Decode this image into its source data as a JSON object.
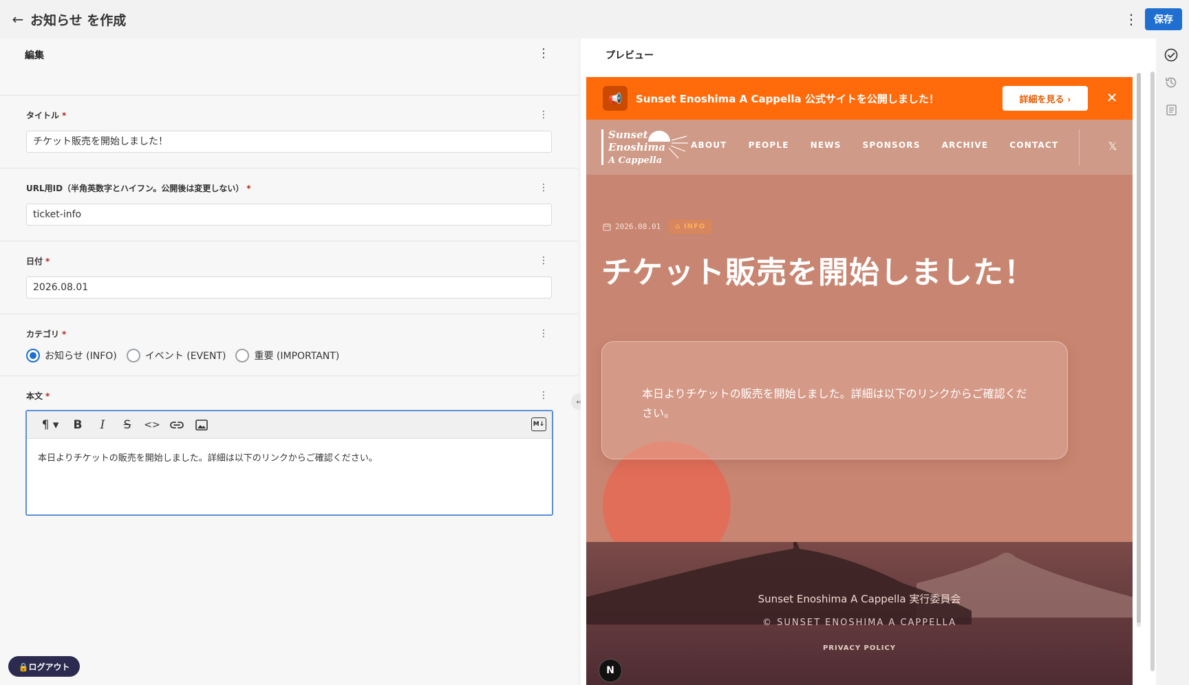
{
  "header": {
    "back_label": "←",
    "title": "お知らせ を作成",
    "more_label": "⋮",
    "save_label": "保存"
  },
  "editor_pane": {
    "title": "編集",
    "more_label": "⋮",
    "fields": {
      "title": {
        "label": "タイトル",
        "required_mark": "*",
        "value": "チケット販売を開始しました！"
      },
      "slug": {
        "label": "URL用ID（半角英数字とハイフン。公開後は変更しない）",
        "required_mark": "*",
        "value": "ticket-info"
      },
      "date": {
        "label": "日付",
        "required_mark": "*",
        "value": "2026.08.01"
      },
      "category": {
        "label": "カテゴリ",
        "required_mark": "*",
        "options": [
          {
            "label": "お知らせ (INFO)",
            "checked": true
          },
          {
            "label": "イベント (EVENT)",
            "checked": false
          },
          {
            "label": "重要 (IMPORTANT)",
            "checked": false
          }
        ]
      },
      "body": {
        "label": "本文",
        "required_mark": "*",
        "toolbar": {
          "paragraph": "¶ ▾",
          "bold": "B",
          "italic": "I",
          "strike": "S",
          "code": "<>",
          "link": "🔗",
          "image": "▣",
          "markdown": "M↓"
        },
        "value": "本日よりチケットの販売を開始しました。詳細は以下のリンクからご確認ください。"
      }
    },
    "field_more_label": "⋮"
  },
  "splitter_label": "↔",
  "logout_label": "🔒ログアウト",
  "preview_pane": {
    "title": "プレビュー",
    "banner": {
      "icon": "megaphone-icon",
      "icon_glyph": "📢",
      "text": "Sunset Enoshima A Cappella 公式サイトを公開しました！",
      "button_label": "詳細を見る ›",
      "close_label": "✕"
    },
    "nav": {
      "logo_lines": [
        "Sunset",
        "Enoshima",
        "A Cappella"
      ],
      "links": [
        "ABOUT",
        "PEOPLE",
        "NEWS",
        "SPONSORS",
        "ARCHIVE",
        "CONTACT"
      ],
      "social_label": "𝕏"
    },
    "post": {
      "date": "2026.08.01",
      "category": "INFO",
      "title": "チケット販売を開始しました！",
      "body": "本日よりチケットの販売を開始しました。詳細は以下のリンクからご確認ください。"
    },
    "footer": {
      "org": "Sunset Enoshima A Cappella 実行委員会",
      "copyright": "© SUNSET ENOSHIMA A CAPPELLA",
      "privacy": "PRIVACY POLICY",
      "badge": "N"
    }
  },
  "right_rail": {
    "icons": [
      "check-circle-icon",
      "history-icon",
      "document-list-icon"
    ]
  },
  "colors": {
    "accent": "#1f6fd1",
    "required": "#b3261e",
    "banner": "#ff6a0a",
    "site_bg": "#c88672"
  }
}
